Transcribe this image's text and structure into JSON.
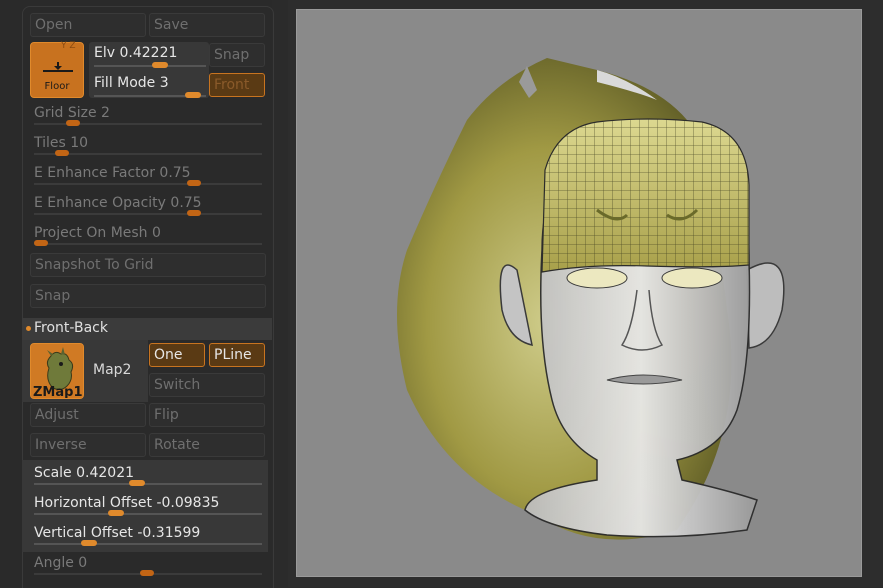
{
  "top": {
    "open_label": "Open",
    "save_label": "Save"
  },
  "floor": {
    "label": "Floor",
    "letters": "Y Z"
  },
  "elv": {
    "label": "Elv",
    "value": "0.42221",
    "level": 0.6
  },
  "fill_mode": {
    "label": "Fill Mode",
    "value": "3",
    "level": 0.95
  },
  "snap_label": "Snap",
  "front_label": "Front",
  "grid_size": {
    "label": "Grid Size",
    "value": "2",
    "level": 0.15
  },
  "tiles": {
    "label": "Tiles",
    "value": "10",
    "level": 0.1
  },
  "e_enhance_factor": {
    "label": "E Enhance Factor",
    "value": "0.75",
    "level": 0.72
  },
  "e_enhance_opacity": {
    "label": "E Enhance Opacity",
    "value": "0.75",
    "level": 0.72
  },
  "project_on_mesh": {
    "label": "Project On Mesh",
    "value": "0",
    "level": 0.0
  },
  "snapshot_to_grid_label": "Snapshot To Grid",
  "snap2_label": "Snap",
  "section": {
    "title": "Front-Back"
  },
  "map": {
    "thumb_label": "ZMap1",
    "name": "Map2"
  },
  "buttons": {
    "one": "One",
    "pline": "PLine",
    "switch": "Switch",
    "adjust": "Adjust",
    "flip": "Flip",
    "inverse": "Inverse",
    "rotate": "Rotate"
  },
  "scale": {
    "label": "Scale",
    "value": "0.42021",
    "level": 0.45
  },
  "horizontal_offset": {
    "label": "Horizontal Offset",
    "value": "-0.09835",
    "level": 0.35
  },
  "vertical_offset": {
    "label": "Vertical Offset",
    "value": "-0.31599",
    "level": 0.22
  },
  "angle": {
    "label": "Angle",
    "value": "0",
    "level": 0.5
  },
  "colors": {
    "accent": "#e08a2c",
    "panel": "#2a2a2a",
    "viewport": "#8a8a8a",
    "sketch": "#b5b04a"
  }
}
